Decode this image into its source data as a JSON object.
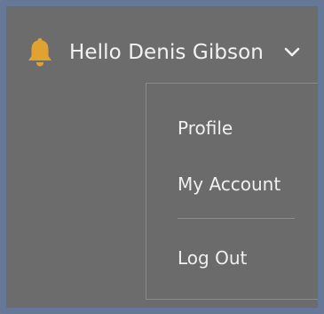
{
  "colors": {
    "frame_border": "#657897",
    "background": "#6c6c6c",
    "bell": "#e0a332",
    "text": "#f2f2f2",
    "divider": "#8c8c8c"
  },
  "header": {
    "bell_icon": "bell-icon",
    "greeting": "Hello Denis Gibson",
    "chevron_icon": "chevron-down-icon"
  },
  "menu": {
    "items": [
      {
        "label": "Profile"
      },
      {
        "label": "My Account"
      },
      {
        "label": "Log Out"
      }
    ]
  }
}
